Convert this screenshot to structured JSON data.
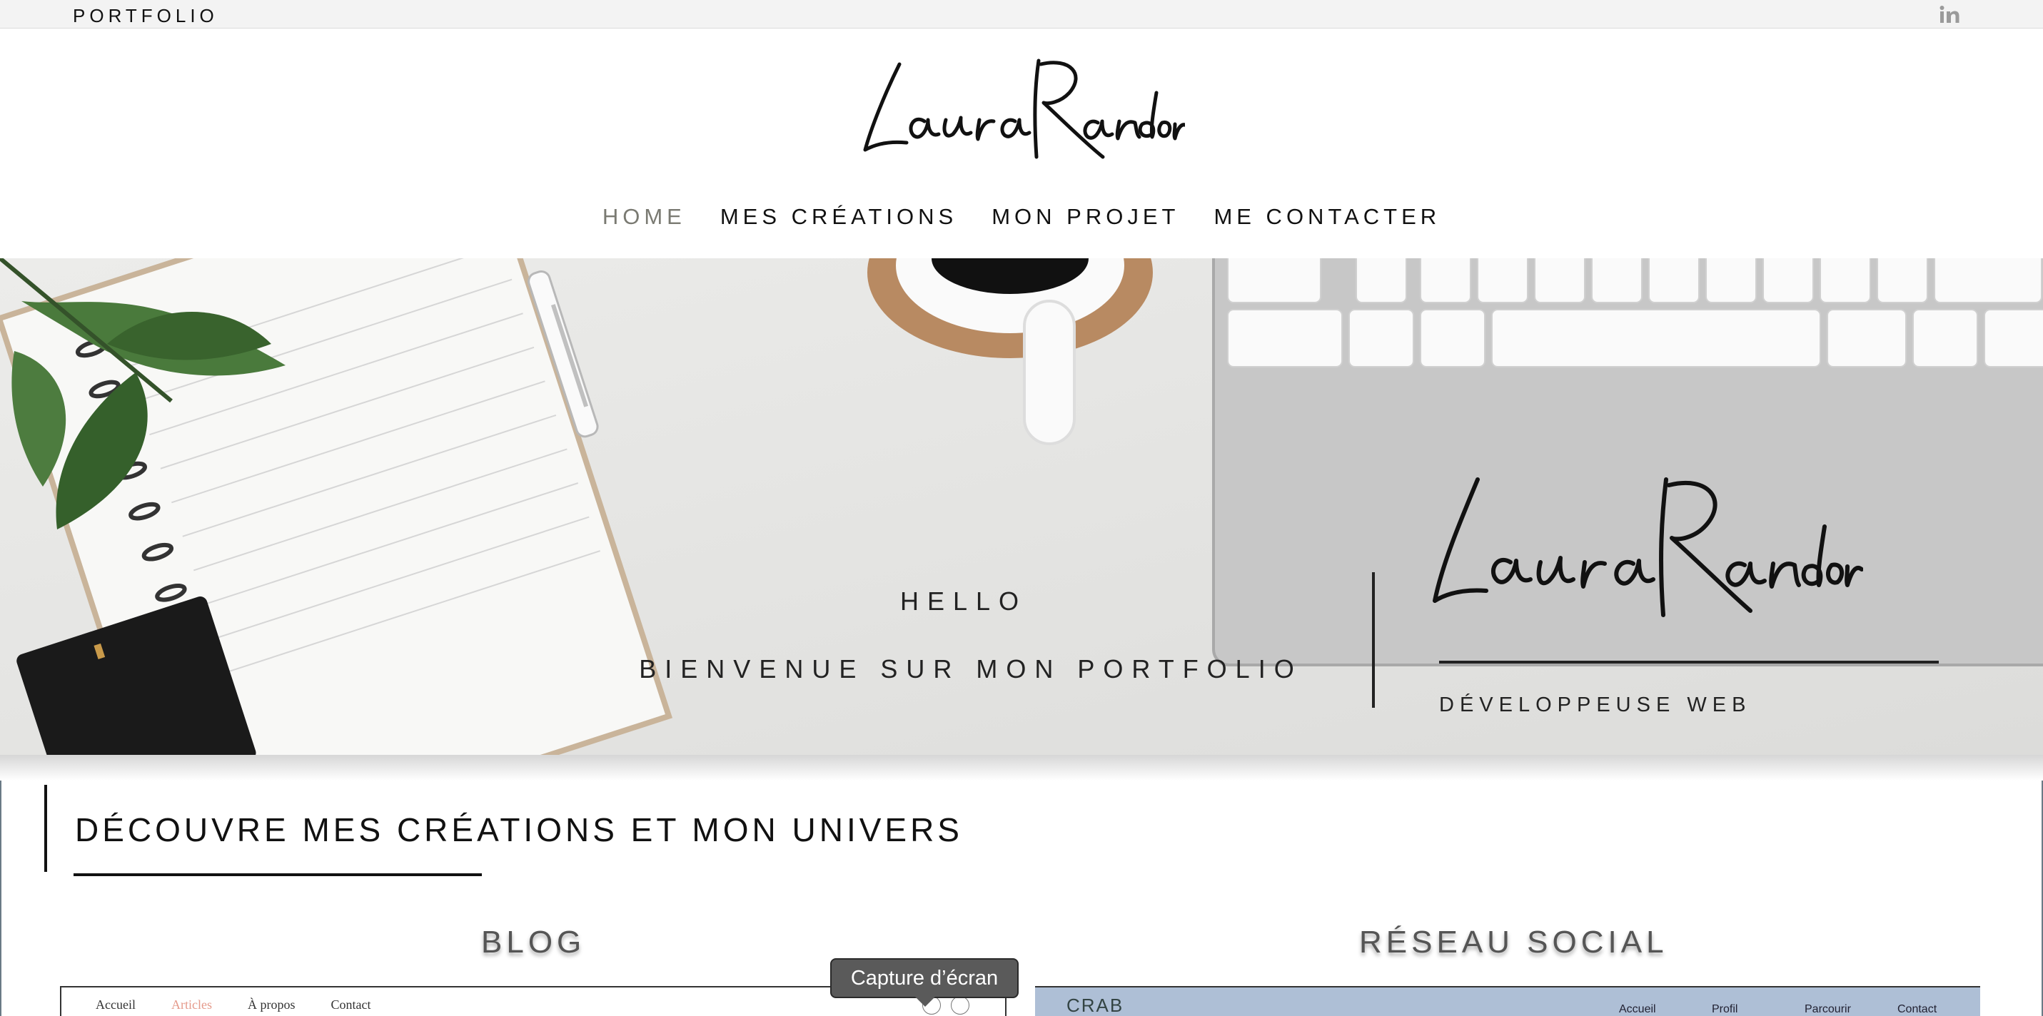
{
  "topbar": {
    "brand": "PORTFOLIO",
    "linkedin_icon": "linkedin-icon"
  },
  "header": {
    "logo_text": "Laura Randon",
    "nav": [
      {
        "label": "HOME",
        "active": true
      },
      {
        "label": "MES CRÉATIONS",
        "active": false
      },
      {
        "label": "MON PROJET",
        "active": false
      },
      {
        "label": "ME CONTACTER",
        "active": false
      }
    ]
  },
  "hero": {
    "hello": "HELLO",
    "welcome": "BIENVENUE SUR MON PORTFOLIO",
    "logo_text": "Laura Randon",
    "role": "DÉVELOPPEUSE WEB"
  },
  "section": {
    "title": "DÉCOUVRE MES CRÉATIONS ET MON UNIVERS",
    "columns": [
      {
        "title": "BLOG"
      },
      {
        "title": "RÉSEAU SOCIAL"
      }
    ]
  },
  "blog_preview": {
    "nav": [
      "Accueil",
      "Articles",
      "À propos",
      "Contact"
    ],
    "accent": "#e59a8b"
  },
  "social_preview": {
    "logo": "CRAB",
    "nav": [
      "Accueil",
      "Profil",
      "Parcourir",
      "Contact"
    ],
    "bg": "#aebfd6"
  },
  "tooltip": {
    "text": "Capture d’écran"
  }
}
